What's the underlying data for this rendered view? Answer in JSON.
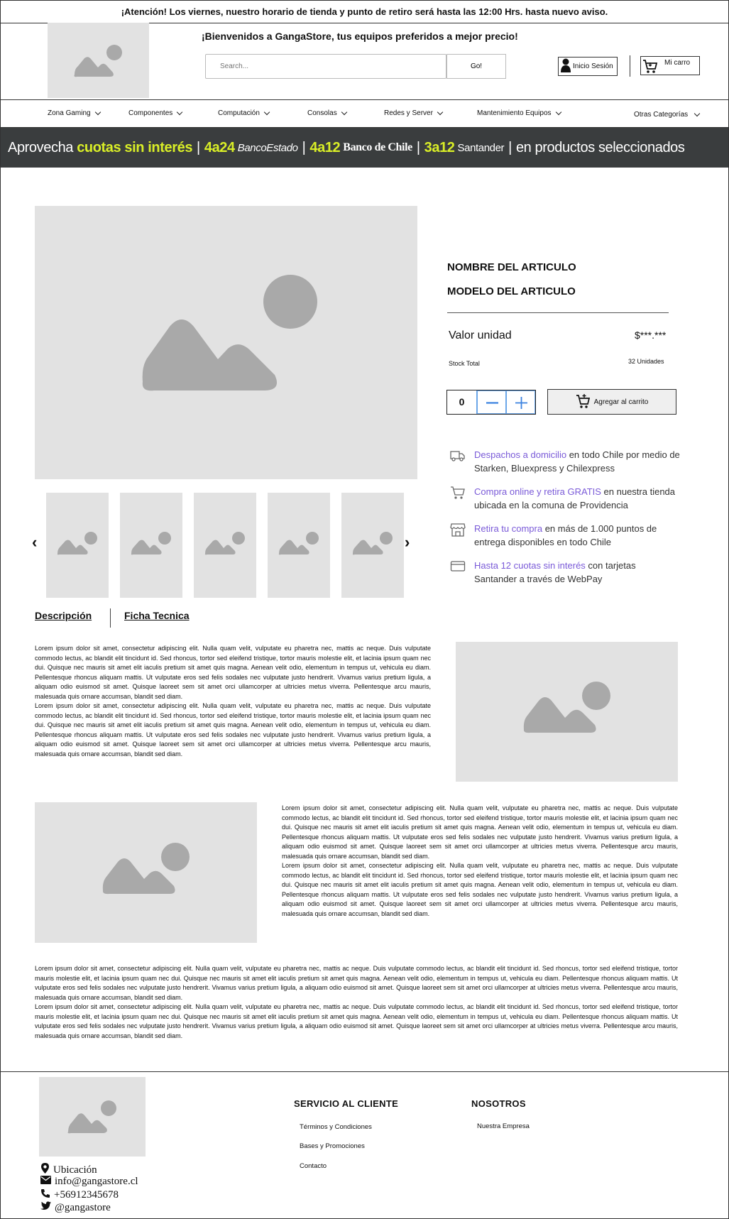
{
  "announcement": "¡Atención! Los viernes, nuestro horario de tienda y punto de retiro será hasta las 12:00 Hrs. hasta nuevo aviso.",
  "header": {
    "welcome": "¡Bienvenidos a GangaStore, tus equipos preferidos a mejor precio!",
    "search_placeholder": "Search...",
    "go_label": "Go!",
    "login_label": "Inicio Sesión",
    "cart_label": "Mi carro"
  },
  "nav": {
    "items": [
      "Zona Gaming",
      "Componentes",
      "Computación",
      "Consolas",
      "Redes y Server",
      "Mantenimiento Equipos",
      "Otras Categorías"
    ]
  },
  "banner": {
    "part1": "Aprovecha ",
    "highlight": "cuotas sin interés",
    "sep": "|",
    "c1": "4a24",
    "bank1": "BancoEstado",
    "c2": "4a12",
    "bank2": "Banco de Chile",
    "c3": "3a12",
    "bank3": "Santander",
    "end": "en productos seleccionados"
  },
  "product": {
    "name": "NOMBRE DEL ARTICULO",
    "model": "MODELO DEL ARTICULO",
    "price_label": "Valor unidad",
    "price": "$***.***",
    "stock_label": "Stock Total",
    "stock_value": "32 Unidades",
    "qty": "0",
    "add_label": "Agregar al carrito"
  },
  "features": [
    {
      "link": "Despachos a domicilio",
      "rest": " en todo Chile por medio de Starken, Bluexpress y Chilexpress",
      "icon": "truck-icon"
    },
    {
      "link": "Compra online y retira GRATIS",
      "rest": " en nuestra tienda ubicada en la comuna de Providencia",
      "icon": "cart-icon"
    },
    {
      "link": "Retira tu compra",
      "rest": " en más de 1.000 puntos de entrega disponibles en todo Chile",
      "icon": "store-icon"
    },
    {
      "link": "Hasta 12 cuotas sin interés",
      "rest": " con tarjetas Santander a través de WebPay",
      "icon": "credit-card-icon"
    }
  ],
  "tabs": {
    "description": "Descripción",
    "specs": "Ficha Tecnica"
  },
  "lorem": "Lorem ipsum dolor sit amet, consectetur adipiscing elit. Nulla quam velit, vulputate eu pharetra nec, mattis ac neque. Duis vulputate commodo lectus, ac blandit elit tincidunt id. Sed rhoncus, tortor sed eleifend tristique, tortor mauris molestie elit, et lacinia ipsum quam nec dui. Quisque nec mauris sit amet elit iaculis pretium sit amet quis magna. Aenean velit odio, elementum in tempus ut, vehicula eu diam. Pellentesque rhoncus aliquam mattis. Ut vulputate eros sed felis sodales nec vulputate justo hendrerit. Vivamus varius pretium ligula, a aliquam odio euismod sit amet. Quisque laoreet sem sit amet orci ullamcorper at ultricies metus viverra. Pellentesque arcu mauris, malesuada quis ornare accumsan, blandit sed diam.",
  "footer": {
    "service_title": "SERVICIO AL CLIENTE",
    "service_links": [
      "Términos y Condiciones",
      "Bases y Promociones",
      "Contacto"
    ],
    "about_title": "NOSOTROS",
    "about_links": [
      "Nuestra Empresa"
    ],
    "location": "Ubicación",
    "email": "info@gangastore.cl",
    "phone": "+56912345678",
    "twitter": "@gangastore"
  }
}
